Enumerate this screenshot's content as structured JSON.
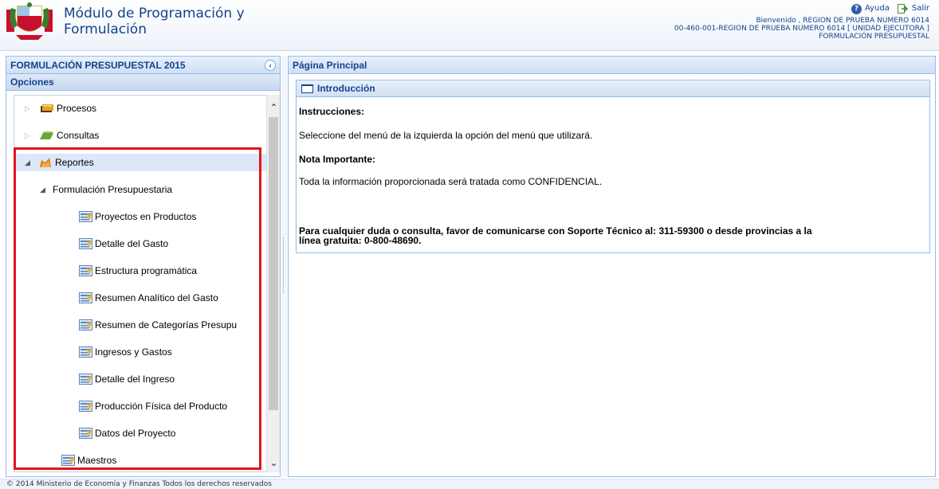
{
  "header": {
    "app_title": "Módulo de Programación y Formulación",
    "help_label": "Ayuda",
    "exit_label": "Salir",
    "welcome_line": "Bienvenido , REGION DE PRUEBA NUMERO 6014",
    "unit_line": "00-460-001-REGION DE PRUEBA NUMERO 6014 [ UNIDAD EJECUTORA ]",
    "module_line": "FORMULACIÓN PRESUPUESTAL"
  },
  "left_panel": {
    "title": "FORMULACIÓN PRESUPUESTAL 2015",
    "options_label": "Opciones",
    "tree": {
      "procesos": "Procesos",
      "consultas": "Consultas",
      "reportes": "Reportes",
      "formulacion": "Formulación Presupuestaria",
      "reports": [
        "Proyectos en Productos",
        "Detalle del Gasto",
        "Estructura programática",
        "Resumen Analítico del Gasto",
        "Resumen de Categorías Presupu",
        "Ingresos y Gastos",
        "Detalle del Ingreso",
        "Producción Física del Producto",
        "Datos del Proyecto"
      ],
      "maestros": "Maestros"
    }
  },
  "main": {
    "title": "Página Principal",
    "intro_title": "Introducción",
    "instructions_heading": "Instrucciones:",
    "instructions_text": "Seleccione del menú de la izquierda la opción del menú que utilizará.",
    "note_heading": "Nota Importante:",
    "note_text": "Toda la información proporcionada será tratada como CONFIDENCIAL.",
    "contact_line1": "Para cualquier duda o consulta, favor de comunicarse con Soporte Técnico al: 311-59300 o desde provincias a la",
    "contact_line2": "línea gratuita: 0-800-48690."
  },
  "footer": {
    "text": "© 2014 Ministerio de Economía y Finanzas Todos los derechos reservados"
  },
  "colors": {
    "header_text": "#15428b",
    "panel_border": "#99bbe8",
    "highlight_box": "#e3141b",
    "selected_row": "#dce8f8"
  }
}
